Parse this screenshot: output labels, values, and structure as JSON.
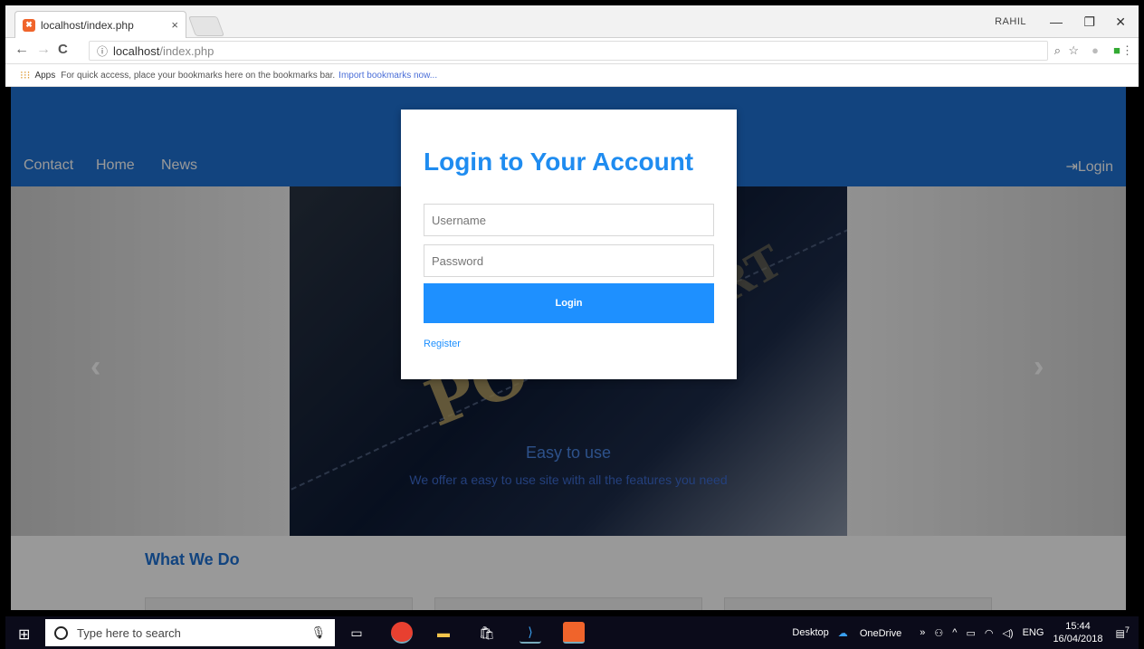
{
  "browser": {
    "tab_title": "localhost/index.php",
    "tab_close": "×",
    "profile_name": "RAHIL",
    "url_host": "localhost",
    "url_path": "/index.php",
    "bookmarks_apps": "Apps",
    "bookmarks_hint": "For quick access, place your bookmarks here on the bookmarks bar.",
    "bookmarks_import": "Import bookmarks now..."
  },
  "site": {
    "nav_items": [
      "Contact",
      "Home",
      "News"
    ],
    "nav_login": "Login",
    "caption_title": "Easy to use",
    "caption_text": "We offer a easy to use site with all the features you need",
    "section_title": "What We Do"
  },
  "modal": {
    "title": "Login to Your Account",
    "username_placeholder": "Username",
    "password_placeholder": "Password",
    "login_button": "Login",
    "register_link": "Register"
  },
  "taskbar": {
    "search_placeholder": "Type here to search",
    "desktop_label": "Desktop",
    "onedrive_label": "OneDrive",
    "language": "ENG",
    "time": "15:44",
    "date": "16/04/2018",
    "notification_count": "7"
  },
  "colors": {
    "accent": "#1e90ff",
    "navbar": "#1f72d4"
  }
}
